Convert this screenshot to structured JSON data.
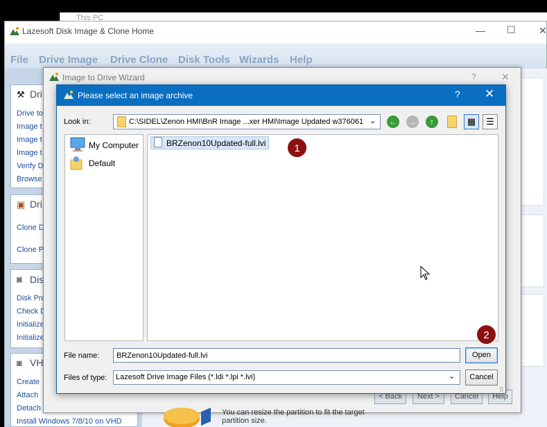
{
  "explorer": {
    "title": "This PC"
  },
  "app": {
    "title": "Lazesoft Disk Image & Clone Home",
    "minimize": "—",
    "maximize": "☐",
    "close": "✕",
    "menu": [
      "File",
      "Drive Image",
      "Drive Clone",
      "Disk Tools",
      "Wizards",
      "Help"
    ]
  },
  "left_pane": {
    "sections": [
      {
        "head": "Dri",
        "links": [
          "Drive to",
          "Image t",
          "Image t",
          "Image t",
          "Verify D",
          "Browse"
        ]
      },
      {
        "head": "Dri",
        "links": [
          "Clone D",
          "Clone P"
        ]
      },
      {
        "head": "Dis",
        "links": [
          "Disk Pro",
          "Check D",
          "Initialize",
          "Initialize"
        ]
      },
      {
        "head": "VH",
        "links": [
          "Create",
          "Attach",
          "Detach",
          "Install Windows 7/8/10 on VHD"
        ]
      }
    ]
  },
  "wizard": {
    "title": "Image to Drive Wizard",
    "help": "?",
    "close": "✕",
    "back_label": "< Back",
    "next_label": "Next >",
    "cancel_label": "Cancel",
    "help_label": "Help",
    "hint_line1": "You can resize the partition to fit the target",
    "hint_line2": "partition size."
  },
  "dialog": {
    "title": "Please select an image archive",
    "help": "?",
    "close": "✕",
    "look_in_label": "Look in:",
    "look_in_path": "C:\\SIDEL\\Zenon HMI\\BnR Image ...xer HMI\\Image Updated w376061",
    "places": [
      "My Computer",
      "Default"
    ],
    "files": [
      "BRZenon10Updated-full.lvi"
    ],
    "file_name_label": "File name:",
    "file_name_value": "BRZenon10Updated-full.lvi",
    "file_type_label": "Files of type:",
    "file_type_value": "Lazesoft Drive Image Files (*.ldi *.lpi *.lvi)",
    "open_label": "Open",
    "cancel_label": "Cancel"
  },
  "markers": [
    "1",
    "2"
  ],
  "colors": {
    "dialog_titlebar": "#0b6fc1",
    "marker": "#8b1010",
    "selection": "#d9e8f8"
  }
}
